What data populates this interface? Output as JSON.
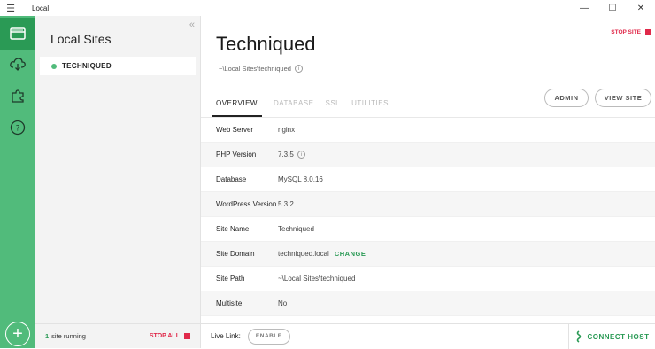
{
  "window": {
    "app_title": "Local",
    "minimize": "—",
    "maximize": "☐",
    "close": "✕"
  },
  "rail": {
    "items": [
      {
        "name": "sites-icon"
      },
      {
        "name": "cloud-icon"
      },
      {
        "name": "addons-icon"
      },
      {
        "name": "help-icon"
      }
    ],
    "add_label": "+"
  },
  "sidebar": {
    "title": "Local Sites",
    "collapse": "«",
    "sites": [
      {
        "name": "TECHNIQUED",
        "status": "running"
      }
    ],
    "footer": {
      "count": "1",
      "running_text": "site running",
      "stop_all": "STOP ALL"
    }
  },
  "site": {
    "title": "Techniqued",
    "path": "~\\Local Sites\\techniqued",
    "stop_site": "STOP SITE",
    "admin_label": "ADMIN",
    "view_site_label": "VIEW SITE",
    "tabs": [
      "OVERVIEW",
      "DATABASE",
      "SSL",
      "UTILITIES"
    ],
    "details": [
      {
        "key": "Web Server",
        "value": "nginx"
      },
      {
        "key": "PHP Version",
        "value": "7.3.5"
      },
      {
        "key": "Database",
        "value": "MySQL 8.0.16"
      },
      {
        "key": "WordPress Version",
        "value": "5.3.2"
      },
      {
        "key": "Site Name",
        "value": "Techniqued"
      },
      {
        "key": "Site Domain",
        "value": "techniqued.local",
        "action": "CHANGE"
      },
      {
        "key": "Site Path",
        "value": "~\\Local Sites\\techniqued"
      },
      {
        "key": "Multisite",
        "value": "No"
      }
    ],
    "live_link_label": "Live Link:",
    "enable_label": "ENABLE",
    "connect_host_label": "CONNECT HOST"
  },
  "colors": {
    "brand_green": "#51bb7b",
    "dark_green": "#2a9a55",
    "stop_red": "#e0294a"
  }
}
